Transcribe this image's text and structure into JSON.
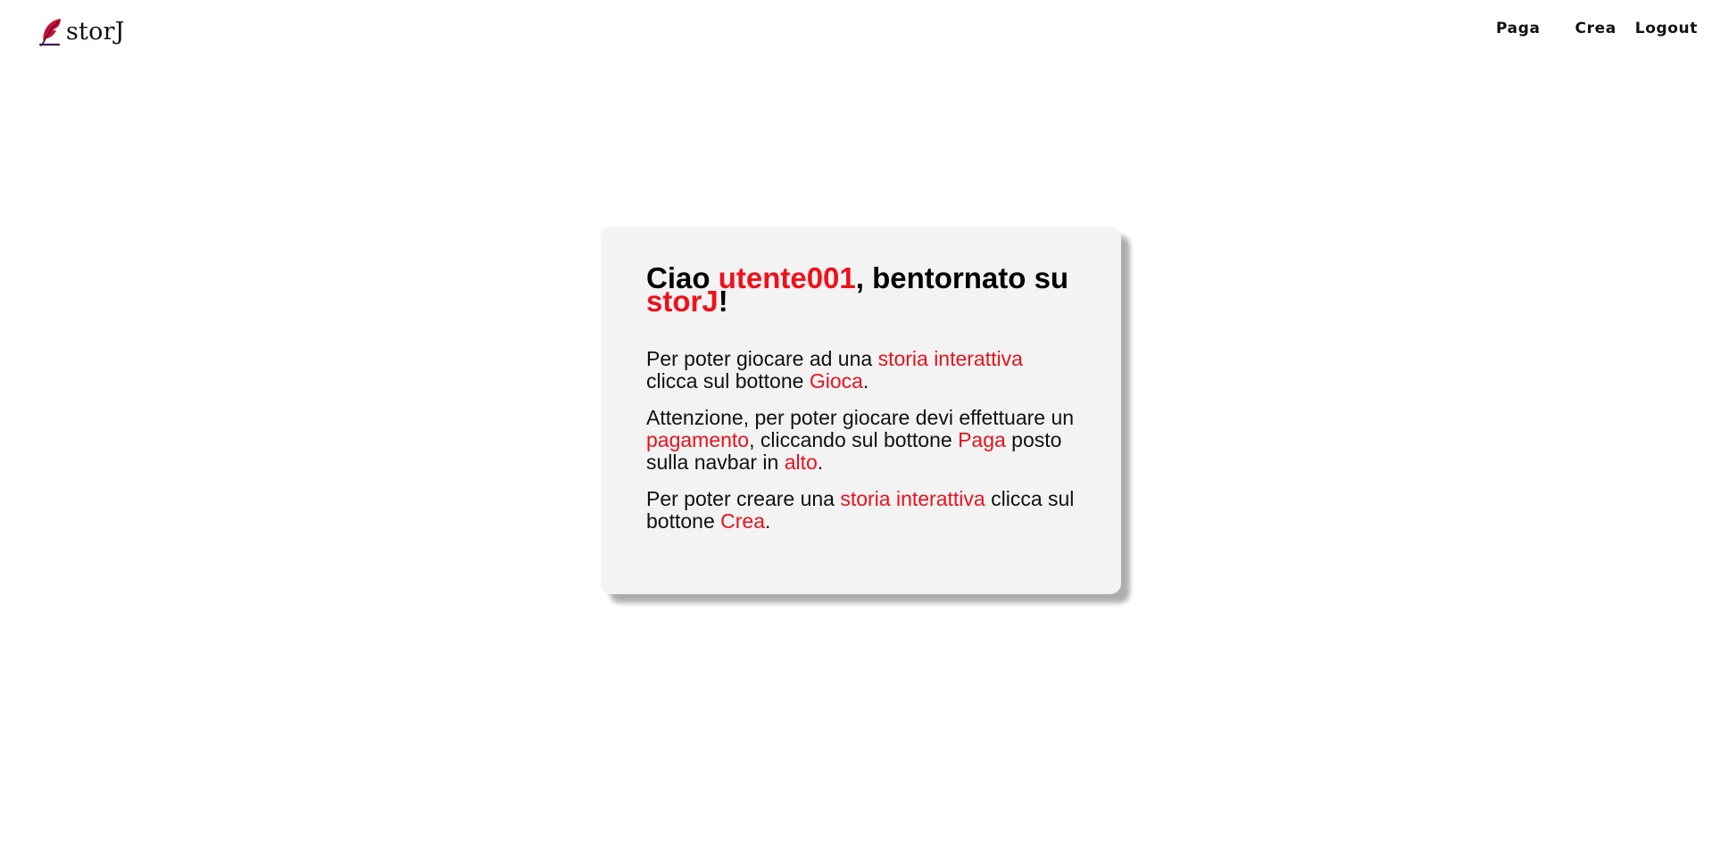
{
  "navbar": {
    "brand": "storJ",
    "links": [
      "Paga",
      "Crea",
      "Logout"
    ]
  },
  "card": {
    "heading": {
      "greeting": "Ciao ",
      "username": "utente001",
      "middle": ", bentornato su ",
      "site": "storJ",
      "end": "!"
    },
    "p1": {
      "t1": "Per poter giocare ad una ",
      "h1": "storia interattiva",
      "t2": " clicca sul bottone ",
      "h2": "Gioca",
      "t3": "."
    },
    "p2": {
      "t1": "Attenzione, per poter giocare devi effettuare un ",
      "h1": "pagamento",
      "t2": ", cliccando sul bottone ",
      "h2": "Paga",
      "t3": " posto sulla navbar in ",
      "h3": "alto",
      "t4": "."
    },
    "p3": {
      "t1": "Per poter creare una ",
      "h1": "storia interattiva",
      "t2": " clicca sul bottone ",
      "h2": "Crea",
      "t3": "."
    }
  },
  "colors": {
    "accent": "#e8121c",
    "card_bg": "#f3f3f3",
    "text": "#111111"
  },
  "icons": {
    "brand": "quill-icon"
  }
}
